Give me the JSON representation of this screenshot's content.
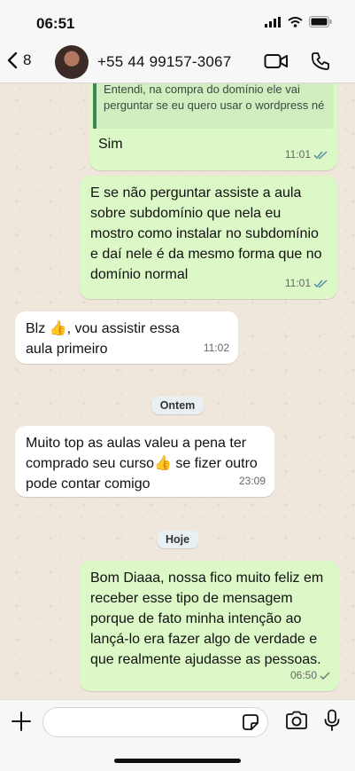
{
  "status": {
    "time": "06:51"
  },
  "header": {
    "back_count": "8",
    "contact": "+55 44 99157-3067"
  },
  "chat": {
    "quoted_text": "Entendi, na compra do domínio ele vai perguntar  se eu quero usar o wordpress né",
    "messages": [
      {
        "dir": "out",
        "text": "Sim",
        "time": "11:01"
      },
      {
        "dir": "out",
        "text": "E se não perguntar assiste a aula sobre subdomínio que nela eu mostro como instalar no subdomínio e daí nele é da mesmo forma que no domínio normal",
        "time": "11:01"
      },
      {
        "dir": "in",
        "text": "Blz 👍, vou assistir essa aula primeiro",
        "time": "11:02"
      },
      {
        "dir": "in",
        "text": "Muito top as aulas valeu a pena ter comprado seu curso👍 se fizer outro pode contar comigo",
        "time": "23:09"
      },
      {
        "dir": "out",
        "text": "Bom Diaaa, nossa fico muito feliz em receber esse tipo de mensagem porque de fato minha intenção ao lançá-lo era fazer algo de verdade e que realmente ajudasse as pessoas.",
        "time": "06:50"
      }
    ],
    "dividers": {
      "yesterday": "Ontem",
      "today": "Hoje"
    }
  },
  "colors": {
    "outgoing": "#dcf8c6",
    "incoming": "#ffffff",
    "read_ticks": "#5b8fa6"
  }
}
